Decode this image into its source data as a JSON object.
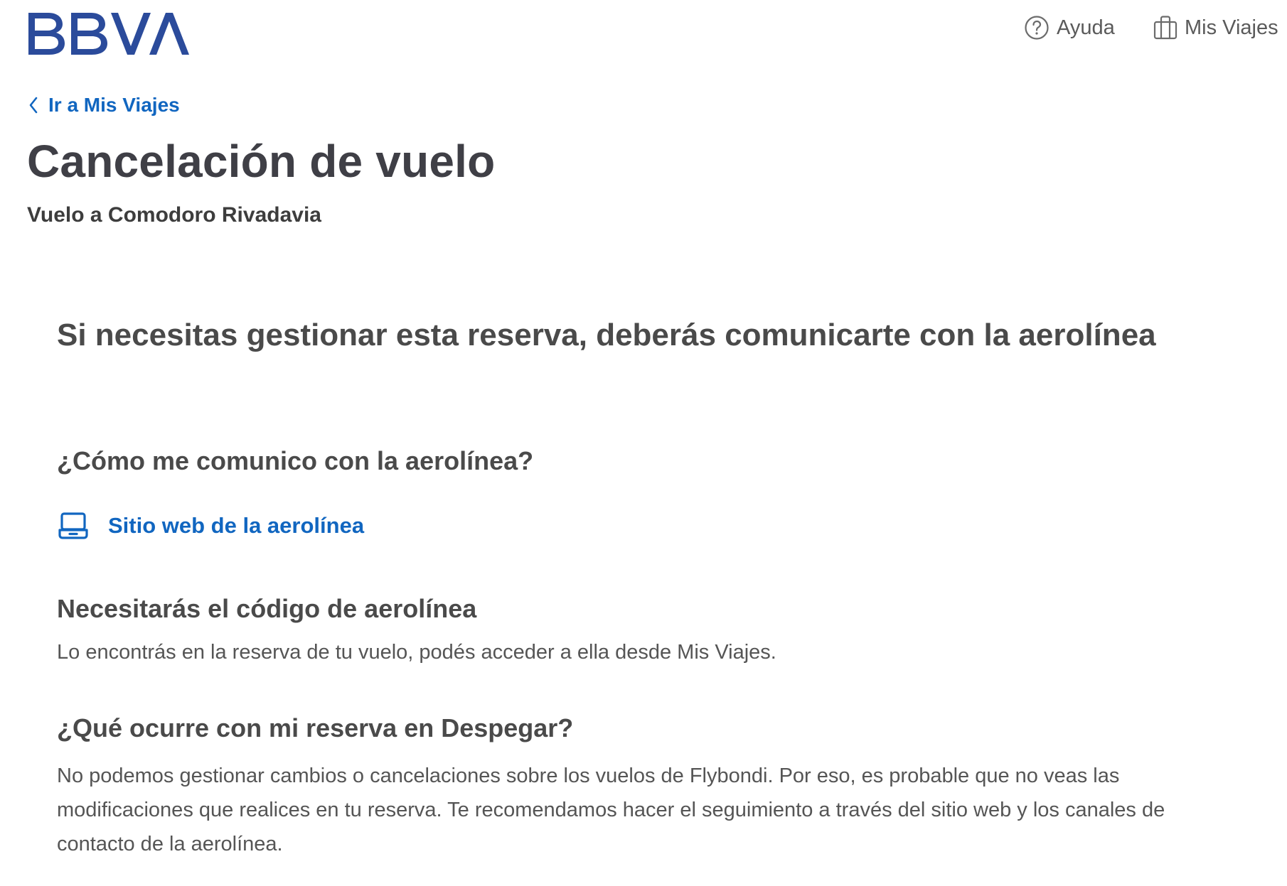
{
  "header": {
    "logo_text": "BBVA",
    "brand_color": "#2b4b9b",
    "nav": {
      "help_label": "Ayuda",
      "help_icon": "question-circle-icon",
      "trips_label": "Mis Viajes",
      "trips_icon": "suitcase-icon"
    }
  },
  "breadcrumb": {
    "back_label": "Ir a Mis Viajes",
    "back_icon": "chevron-left-icon"
  },
  "page": {
    "title": "Cancelación de vuelo",
    "subtitle": "Vuelo a Comodoro Rivadavia"
  },
  "main": {
    "heading": "Si necesitas gestionar esta reserva, deberás comunicarte con la aerolínea",
    "contact_section": {
      "heading": "¿Cómo me comunico con la aerolínea?",
      "web_link_label": "Sitio web de la aerolínea",
      "web_link_icon": "laptop-icon"
    },
    "code_section": {
      "heading": "Necesitarás el código de aerolínea",
      "description": "Lo encontrás en la reserva de tu vuelo, podés acceder a ella desde Mis Viajes."
    },
    "despegar_section": {
      "heading": "¿Qué ocurre con mi reserva en Despegar?",
      "description": "No podemos gestionar cambios o cancelaciones sobre los vuelos de Flybondi. Por eso, es probable que no veas las modificaciones que realices en tu reserva. Te recomendamos hacer el seguimiento a través del sitio web y los canales de contacto de la aerolínea."
    }
  },
  "colors": {
    "link": "#1166c0",
    "title_text": "#3f3f46",
    "body_text": "#555555"
  }
}
